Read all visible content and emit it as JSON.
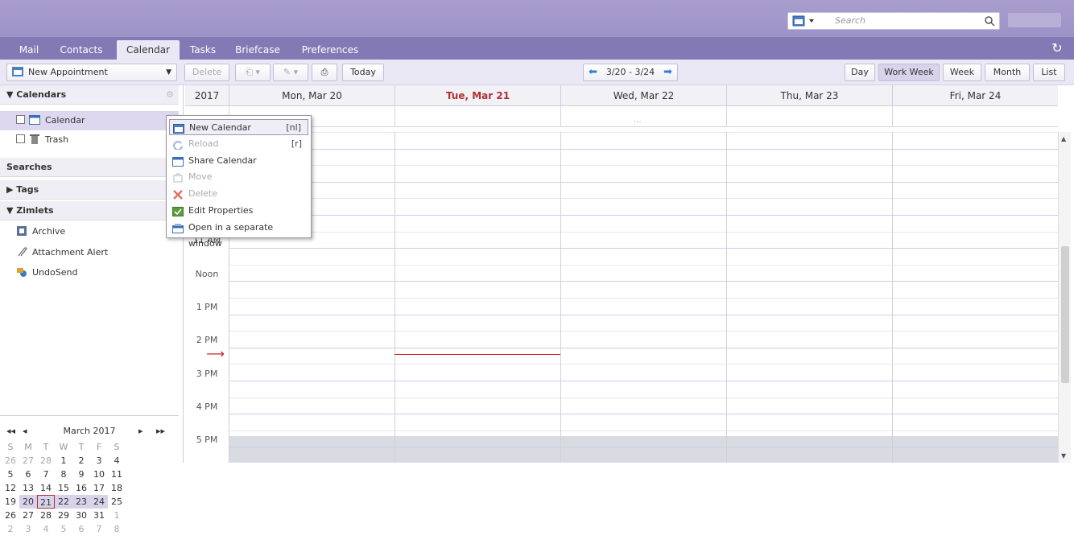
{
  "search": {
    "placeholder": "Search"
  },
  "tabs": [
    {
      "label": "Mail"
    },
    {
      "label": "Contacts"
    },
    {
      "label": "Calendar"
    },
    {
      "label": "Tasks"
    },
    {
      "label": "Briefcase"
    },
    {
      "label": "Preferences"
    }
  ],
  "toolbar": {
    "new_appointment": "New Appointment",
    "delete": "Delete",
    "today": "Today",
    "date_range": "3/20 - 3/24",
    "views": [
      "Day",
      "Work Week",
      "Week",
      "Month",
      "List"
    ]
  },
  "left": {
    "calendars_header": "Calendars",
    "calendars": [
      "Calendar",
      "Trash"
    ],
    "searches_header": "Searches",
    "tags_header": "Tags",
    "zimlets_header": "Zimlets",
    "zimlets": [
      "Archive",
      "Attachment Alert",
      "UndoSend"
    ]
  },
  "minical": {
    "title": "March 2017",
    "weekdays": [
      "S",
      "M",
      "T",
      "W",
      "T",
      "F",
      "S"
    ],
    "weeks": [
      [
        "26",
        "27",
        "28",
        "1",
        "2",
        "3",
        "4"
      ],
      [
        "5",
        "6",
        "7",
        "8",
        "9",
        "10",
        "11"
      ],
      [
        "12",
        "13",
        "14",
        "15",
        "16",
        "17",
        "18"
      ],
      [
        "19",
        "20",
        "21",
        "22",
        "23",
        "24",
        "25"
      ],
      [
        "26",
        "27",
        "28",
        "29",
        "30",
        "31",
        "1"
      ],
      [
        "2",
        "3",
        "4",
        "5",
        "6",
        "7",
        "8"
      ]
    ]
  },
  "calendar": {
    "year": "2017",
    "days": [
      "Mon, Mar 20",
      "Tue, Mar 21",
      "Wed, Mar 22",
      "Thu, Mar 23",
      "Fri, Mar 24"
    ],
    "today_color": "#b03030",
    "hours": [
      "11 AM",
      "Noon",
      "1 PM",
      "2 PM",
      "3 PM",
      "4 PM",
      "5 PM"
    ],
    "more": "..."
  },
  "context_menu": {
    "items": [
      {
        "label": "New Calendar",
        "shortcut": "[nl]",
        "disabled": false
      },
      {
        "label": "Reload",
        "shortcut": "[r]",
        "disabled": true
      },
      {
        "label": "Share Calendar",
        "shortcut": "",
        "disabled": false
      },
      {
        "label": "Move",
        "shortcut": "",
        "disabled": true
      },
      {
        "label": "Delete",
        "shortcut": "",
        "disabled": true
      },
      {
        "label": "Edit Properties",
        "shortcut": "",
        "disabled": false
      },
      {
        "label": "Open in a separate window",
        "shortcut": "",
        "disabled": false
      }
    ]
  },
  "colors": {
    "brand": "#9d92c6",
    "tabbar": "#8379b5",
    "now_line": "#cc2222"
  }
}
